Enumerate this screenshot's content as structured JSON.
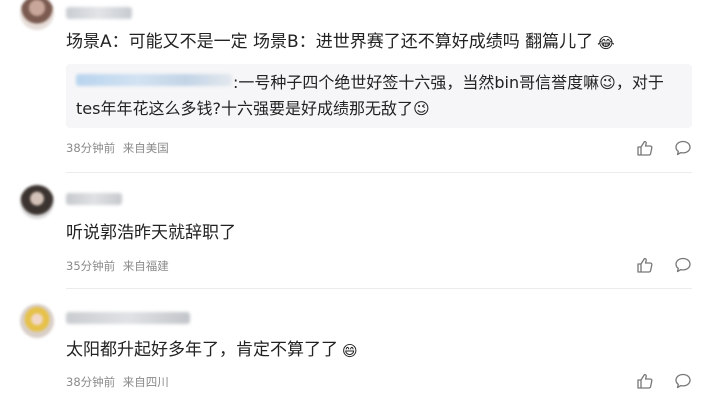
{
  "comments": [
    {
      "text": "场景A：可能又不是一定 场景B：进世界赛了还不算好成绩吗 翻篇儿了",
      "emoji": "😂",
      "quote": {
        "text": ":一号种子四个绝世好签十六强，当然bin哥信誉度嘛😉，对于tes年年花这么多钱?十六强要是好成绩那无敌了😉"
      },
      "time": "38分钟前",
      "location": "来自美国",
      "icons": {
        "like": "thumbs-up-icon",
        "reply": "comment-icon"
      }
    },
    {
      "text": "听说郭浩昨天就辞职了",
      "emoji": "",
      "time": "35分钟前",
      "location": "来自福建",
      "icons": {
        "like": "thumbs-up-icon",
        "reply": "comment-icon"
      }
    },
    {
      "text": "太阳都升起好多年了，肯定不算了了",
      "emoji": "😄",
      "time": "38分钟前",
      "location": "来自四川",
      "icons": {
        "like": "thumbs-up-icon",
        "reply": "comment-icon"
      }
    }
  ],
  "colors": {
    "text": "#222222",
    "meta": "#8a8a8a",
    "quote_bg": "#f6f6f8",
    "divider": "#ececec"
  }
}
